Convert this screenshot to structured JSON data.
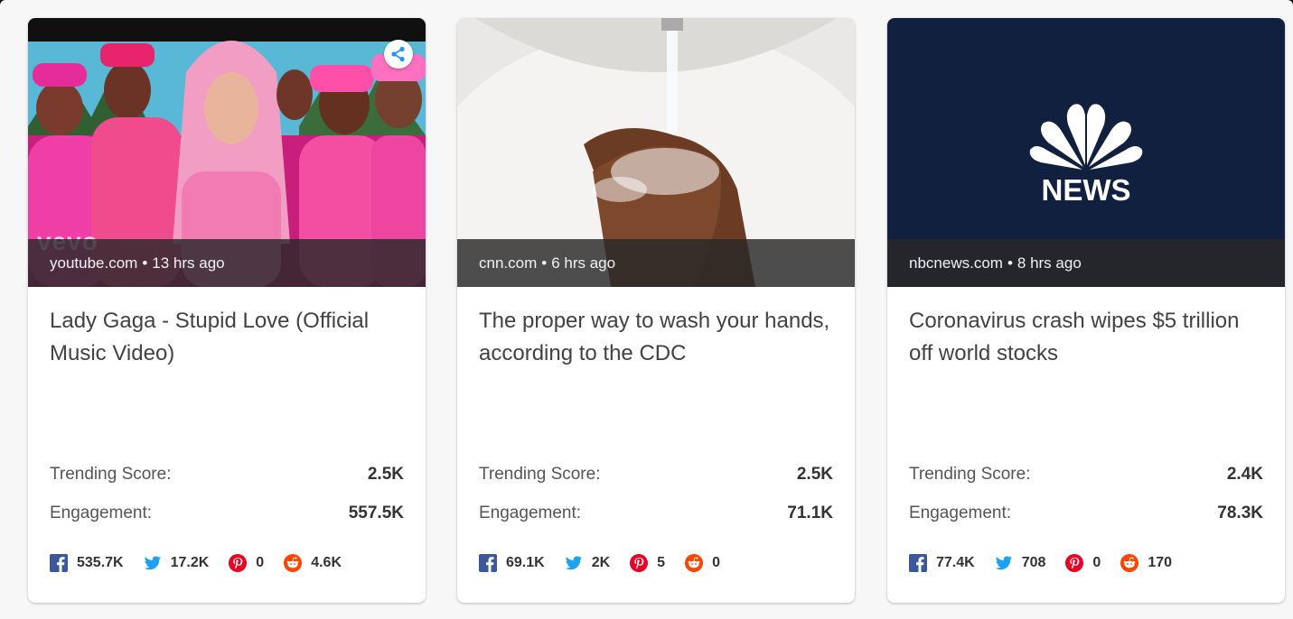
{
  "colors": {
    "facebook": "#3b5998",
    "twitter": "#1da1f2",
    "pinterest": "#e60023",
    "reddit": "#ff4500",
    "share_icon": "#2196f3",
    "nbc_navy": "#12203f"
  },
  "labels": {
    "trending": "Trending Score:",
    "engagement": "Engagement:"
  },
  "cards": [
    {
      "source": "youtube.com",
      "separator": "•",
      "time": "13 hrs ago",
      "title": "Lady Gaga - Stupid Love (Official Music Video)",
      "trending_score": "2.5K",
      "engagement": "557.5K",
      "thumb_watermark": "vevo",
      "has_share_icon": true,
      "social": {
        "facebook": "535.7K",
        "twitter": "17.2K",
        "pinterest": "0",
        "reddit": "4.6K"
      }
    },
    {
      "source": "cnn.com",
      "separator": "•",
      "time": "6 hrs ago",
      "title": "The proper way to wash your hands, according to the CDC",
      "trending_score": "2.5K",
      "engagement": "71.1K",
      "social": {
        "facebook": "69.1K",
        "twitter": "2K",
        "pinterest": "5",
        "reddit": "0"
      }
    },
    {
      "source": "nbcnews.com",
      "separator": "•",
      "time": "8 hrs ago",
      "title": "Coronavirus crash wipes $5 trillion off world stocks",
      "trending_score": "2.4K",
      "engagement": "78.3K",
      "logo_text": "NEWS",
      "social": {
        "facebook": "77.4K",
        "twitter": "708",
        "pinterest": "0",
        "reddit": "170"
      }
    }
  ]
}
